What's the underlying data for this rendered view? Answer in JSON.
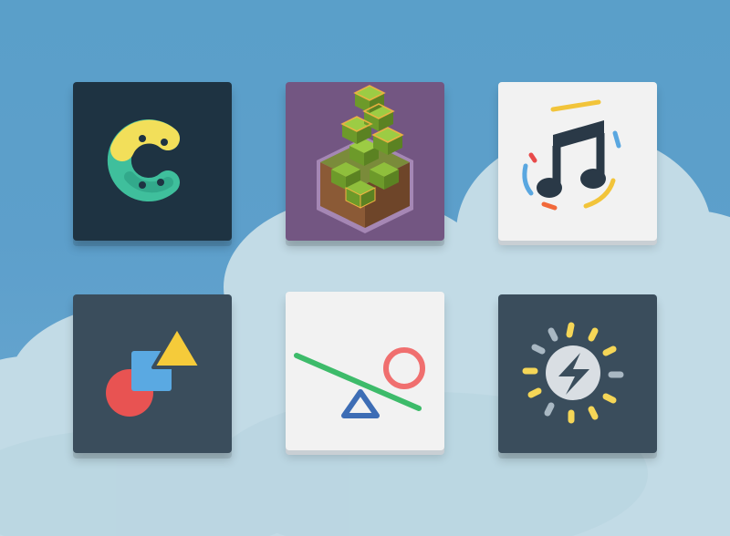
{
  "scene": {
    "sky_color": "#5d9fcb",
    "cloud_color": "#c3dce7"
  },
  "icons": [
    {
      "name": "c-logo-icon",
      "background": "#1e3342"
    },
    {
      "name": "voxel-grass-block-icon",
      "background": "#735682"
    },
    {
      "name": "music-note-icon",
      "background": "#f2f2f2"
    },
    {
      "name": "geometric-shapes-icon",
      "background": "#3a4d5c"
    },
    {
      "name": "seesaw-balance-icon",
      "background": "#f2f2f2"
    },
    {
      "name": "sun-lightning-brightness-icon",
      "background": "#3a4d5c"
    }
  ]
}
